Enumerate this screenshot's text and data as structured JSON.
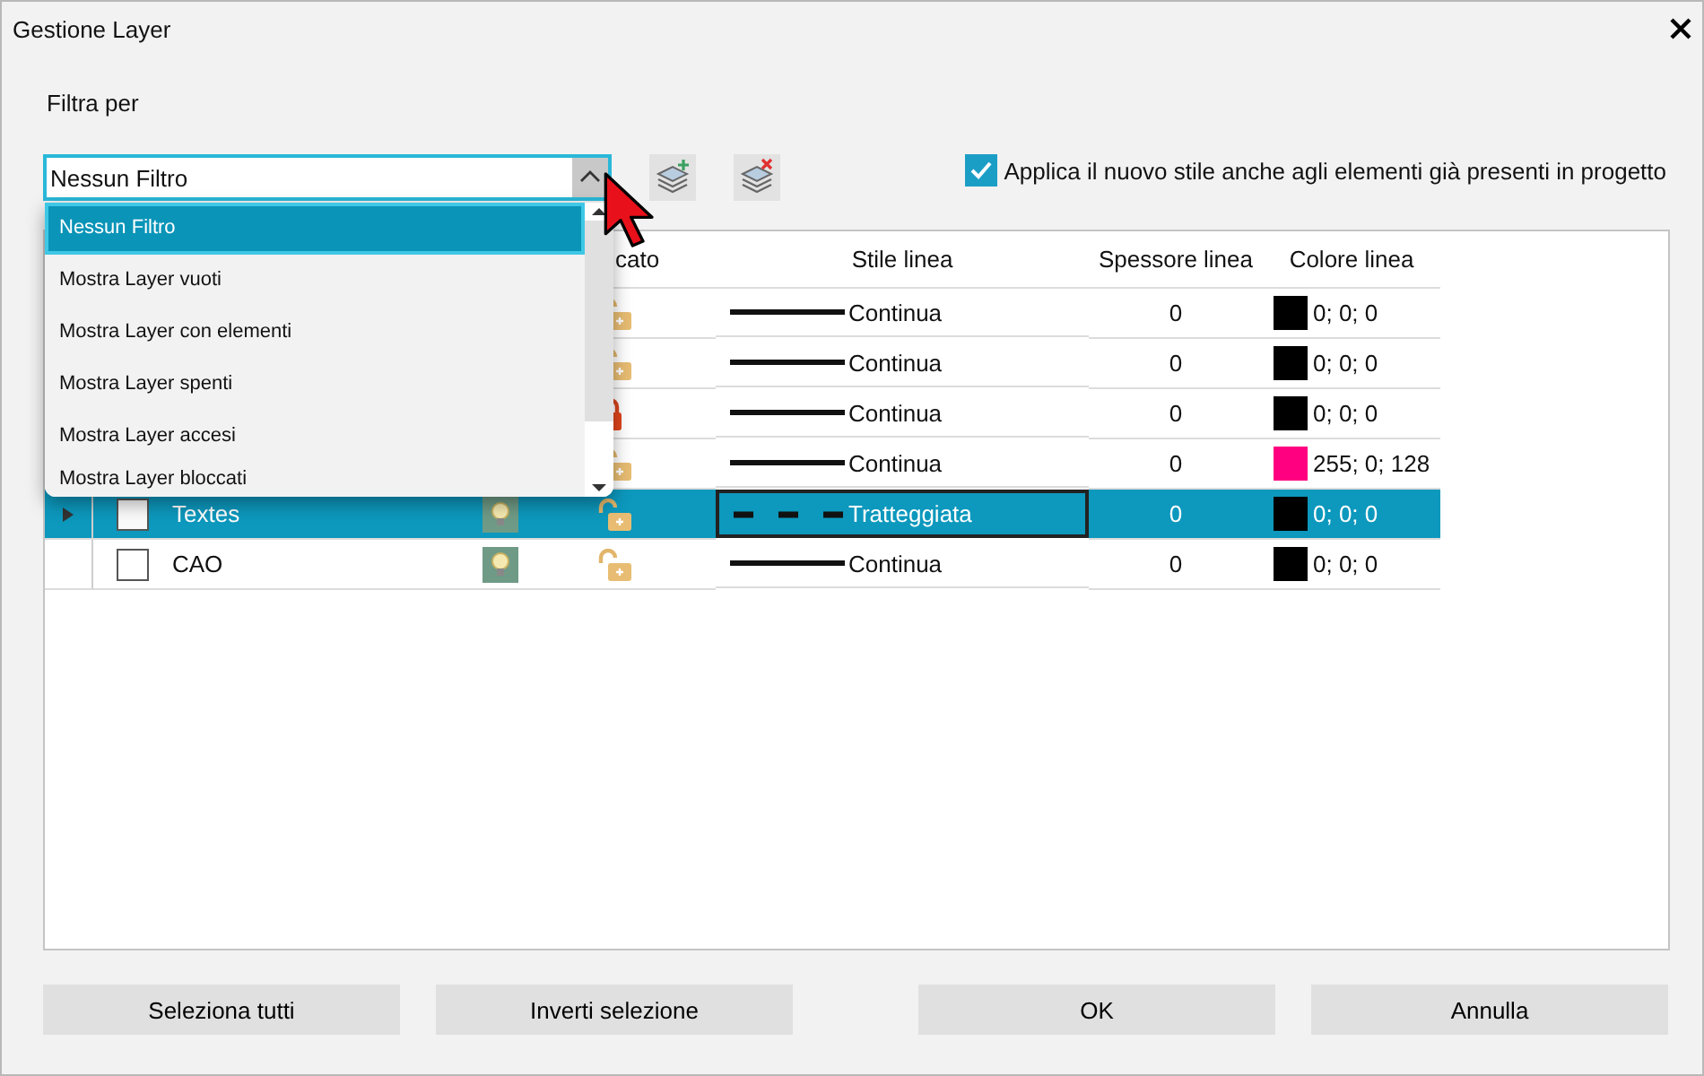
{
  "window": {
    "title": "Gestione Layer"
  },
  "filter": {
    "label": "Filtra per",
    "value": "Nessun Filtro",
    "open": true,
    "options": [
      {
        "label": "Nessun Filtro",
        "selected": true
      },
      {
        "label": "Mostra Layer vuoti",
        "selected": false
      },
      {
        "label": "Mostra Layer con elementi",
        "selected": false
      },
      {
        "label": "Mostra Layer spenti",
        "selected": false
      },
      {
        "label": "Mostra Layer accesi",
        "selected": false
      },
      {
        "label": "Mostra Layer bloccati",
        "selected": false
      }
    ]
  },
  "apply_option": {
    "label": "Applica il nuovo stile anche agli elementi già presenti in progetto",
    "checked": true
  },
  "table": {
    "columns": [
      "cato",
      "Stile linea",
      "Spessore linea",
      "Colore linea"
    ],
    "rows": [
      {
        "locked": false,
        "kind": "solid",
        "line_style": "Continua",
        "thickness": "0",
        "color": "#000000",
        "color_text": "0; 0; 0",
        "selected": false
      },
      {
        "locked": false,
        "kind": "solid",
        "line_style": "Continua",
        "thickness": "0",
        "color": "#000000",
        "color_text": "0; 0; 0",
        "selected": false
      },
      {
        "locked": true,
        "kind": "solid",
        "line_style": "Continua",
        "thickness": "0",
        "color": "#000000",
        "color_text": "0; 0; 0",
        "selected": false
      },
      {
        "locked": false,
        "kind": "solid",
        "line_style": "Continua",
        "thickness": "0",
        "color": "#ff0080",
        "color_text": "255; 0; 128",
        "selected": false
      },
      {
        "name": "Textes",
        "checked": false,
        "locked": false,
        "kind": "dashed",
        "line_style": "Tratteggiata",
        "thickness": "0",
        "color": "#000000",
        "color_text": "0; 0; 0",
        "selected": true
      },
      {
        "name": "CAO",
        "checked": false,
        "locked": false,
        "kind": "solid",
        "line_style": "Continua",
        "thickness": "0",
        "color": "#000000",
        "color_text": "0; 0; 0",
        "selected": false
      }
    ]
  },
  "buttons": [
    "Seleziona tutti",
    "Inverti selezione",
    "OK",
    "Annulla"
  ]
}
